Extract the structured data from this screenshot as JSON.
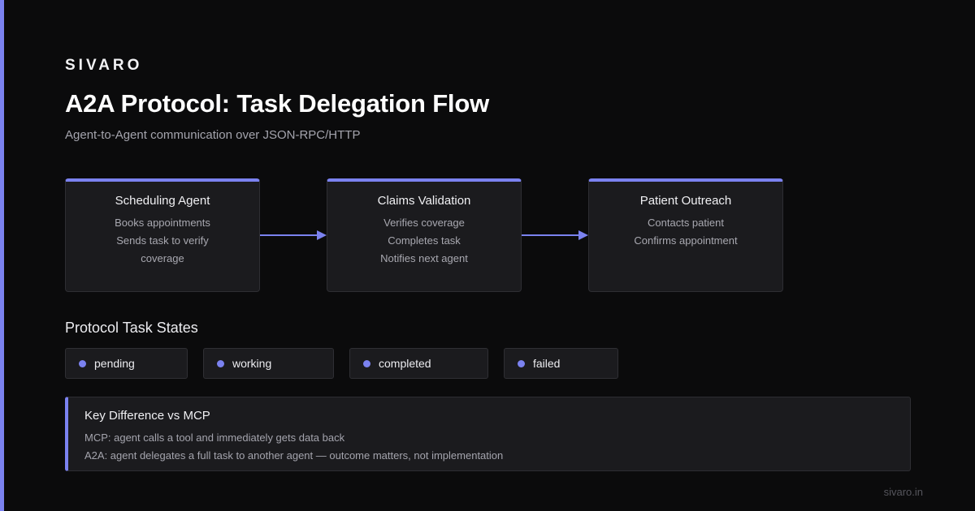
{
  "brand": "SIVARO",
  "title": "A2A Protocol: Task Delegation Flow",
  "subtitle": "Agent-to-Agent communication over JSON-RPC/HTTP",
  "accent_color": "#7b82f0",
  "flow": {
    "agents": [
      {
        "title": "Scheduling Agent",
        "lines": [
          "Books appointments",
          "Sends task to verify",
          "coverage"
        ]
      },
      {
        "title": "Claims Validation",
        "lines": [
          "Verifies coverage",
          "Completes task",
          "Notifies next agent"
        ]
      },
      {
        "title": "Patient Outreach",
        "lines": [
          "Contacts patient",
          "Confirms appointment"
        ]
      }
    ]
  },
  "states": {
    "title": "Protocol Task States",
    "items": [
      "pending",
      "working",
      "completed",
      "failed"
    ]
  },
  "note": {
    "title": "Key Difference vs MCP",
    "lines": [
      "MCP: agent calls a tool and immediately gets data back",
      "A2A: agent delegates a full task to another agent — outcome matters, not implementation"
    ]
  },
  "footer": "sivaro.in"
}
